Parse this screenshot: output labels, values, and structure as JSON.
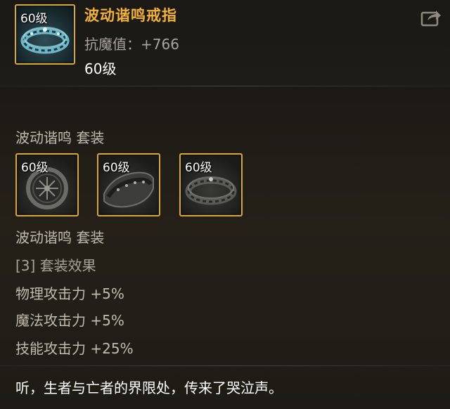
{
  "item": {
    "level_badge": "60级",
    "name": "波动谐鸣戒指",
    "stat_line": "抗魔值：+766",
    "required_level": "60级"
  },
  "set": {
    "title_top": "波动谐鸣  套装",
    "pieces": [
      {
        "level": "60级",
        "icon": "bracelet-icon"
      },
      {
        "level": "60级",
        "icon": "armband-icon"
      },
      {
        "level": "60级",
        "icon": "ring-icon"
      }
    ],
    "title_bottom": "波动谐鸣  套装",
    "bonus_header": "[3] 套装效果",
    "bonuses": [
      "物理攻击力 +5%",
      "魔法攻击力 +5%",
      "技能攻击力 +25%"
    ]
  },
  "flavor_text": "听，生者与亡者的界限处，传来了哭泣声。",
  "colors": {
    "item_name": "#f2b233",
    "slot_border": "#d9a63a",
    "muted_text": "#a9a49a",
    "white_text": "#ffffff"
  }
}
